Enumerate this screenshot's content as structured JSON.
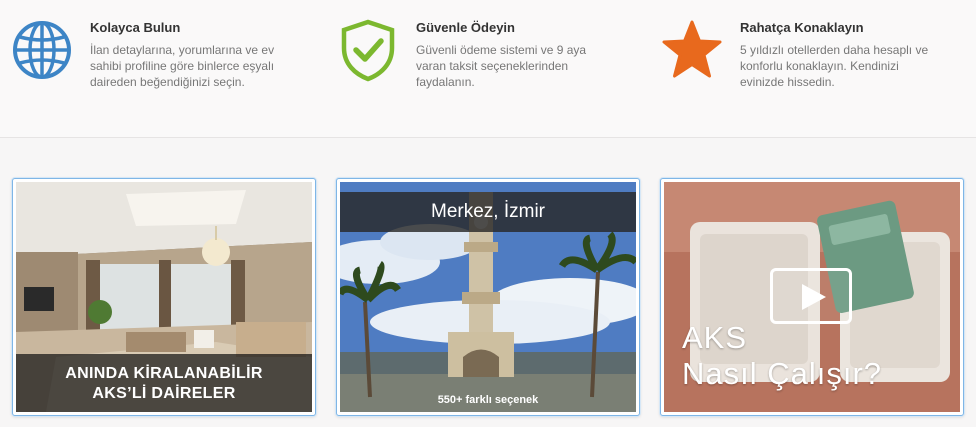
{
  "features": [
    {
      "icon": "globe-icon",
      "title": "Kolayca Bulun",
      "desc": "İlan detaylarına, yorumlarına ve ev sahibi profiline göre binlerce eşyalı daireden beğendiğinizi seçin.",
      "color": "#3d85c6"
    },
    {
      "icon": "shield-check-icon",
      "title": "Güvenle Ödeyin",
      "desc": "Güvenli ödeme sistemi ve 9 aya varan taksit seçeneklerinden faydalanın.",
      "color": "#7cb82f"
    },
    {
      "icon": "star-icon",
      "title": "Rahatça Konaklayın",
      "desc": "5 yıldızlı otellerden daha hesaplı ve konforlu konaklayın. Kendinizi evinizde hissedin.",
      "color": "#e8691d"
    }
  ],
  "cards": {
    "interior": {
      "line1": "ANINDA KİRALANABİLİR",
      "line2": "AKS’Lİ DAİRELER"
    },
    "city": {
      "title": "Merkez, İzmir",
      "count": "550+ farklı seçenek"
    },
    "video": {
      "line1": "AKS",
      "line2": "Nasıl Çalışır?",
      "icon": "play-icon"
    }
  }
}
